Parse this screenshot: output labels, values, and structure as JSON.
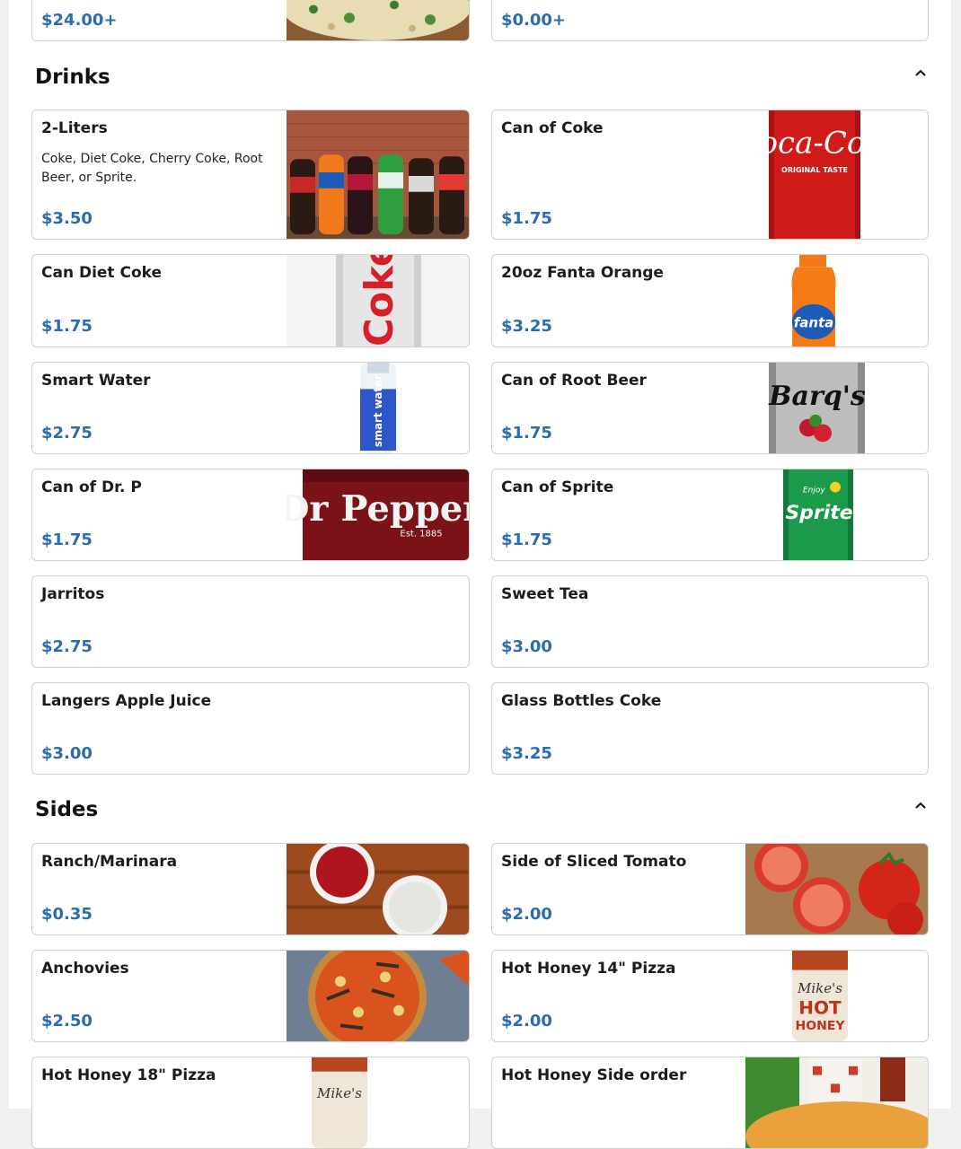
{
  "top_row": {
    "left_price": "$24.00+",
    "right_price": "$0.00+"
  },
  "drinks": {
    "title": "Drinks",
    "collapse_icon": "chevron-up-icon",
    "items": [
      {
        "name": "2-Liters",
        "desc": "Coke, Diet Coke, Cherry Coke, Root Beer, or Sprite.",
        "price": "$3.50"
      },
      {
        "name": "Can of Coke",
        "price": "$1.75"
      },
      {
        "name": "Can Diet Coke",
        "price": "$1.75"
      },
      {
        "name": "20oz Fanta Orange",
        "price": "$3.25"
      },
      {
        "name": "Smart Water",
        "price": "$2.75"
      },
      {
        "name": "Can of Root Beer",
        "price": "$1.75"
      },
      {
        "name": "Can of Dr. P",
        "price": "$1.75"
      },
      {
        "name": "Can of Sprite",
        "price": "$1.75"
      },
      {
        "name": "Jarritos",
        "price": "$2.75"
      },
      {
        "name": "Sweet Tea",
        "price": "$3.00"
      },
      {
        "name": "Langers Apple Juice",
        "price": "$3.00"
      },
      {
        "name": "Glass Bottles Coke",
        "price": "$3.25"
      }
    ]
  },
  "sides": {
    "title": "Sides",
    "collapse_icon": "chevron-up-icon",
    "items": [
      {
        "name": "Ranch/Marinara",
        "price": "$0.35"
      },
      {
        "name": "Side of Sliced Tomato",
        "price": "$2.00"
      },
      {
        "name": "Anchovies",
        "price": "$2.50"
      },
      {
        "name": "Hot Honey 14\" Pizza",
        "price": "$2.00"
      },
      {
        "name": "Hot Honey 18\" Pizza"
      },
      {
        "name": "Hot Honey Side order"
      }
    ]
  },
  "image_text": {
    "coke_can": "Coca-Cola",
    "coke_can_sub": "ORIGINAL TASTE",
    "diet_coke": "Coke",
    "fanta": "fanta",
    "smart_water": "smart water",
    "barqs": "Barq's",
    "dr_pepper": "Dr Pepper",
    "dr_pepper_sub": "Est. 1885",
    "sprite": "Sprite",
    "sprite_sub": "Enjoy",
    "hot_honey_brand": "Mike's",
    "hot_honey_label": "HOT",
    "hot_honey_label2": "HONEY"
  },
  "colors": {
    "price": "#2b6cb0",
    "border": "#cfcfcf"
  }
}
